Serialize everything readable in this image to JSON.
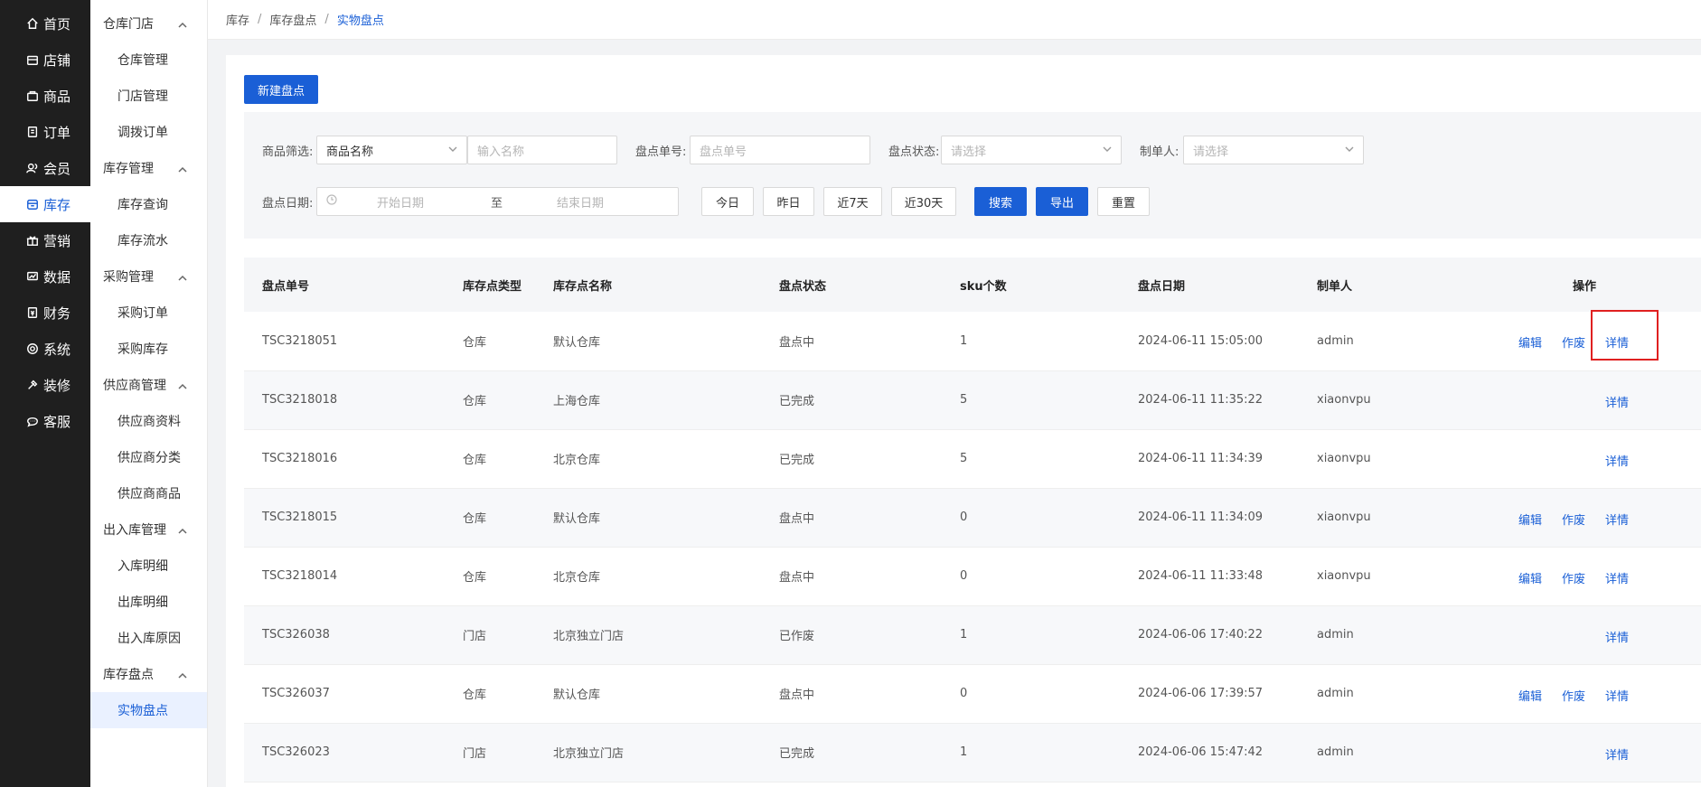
{
  "nav_primary": [
    {
      "label": "首页",
      "icon": "home-icon",
      "active": false
    },
    {
      "label": "店铺",
      "icon": "shop-icon",
      "active": false
    },
    {
      "label": "商品",
      "icon": "goods-icon",
      "active": false
    },
    {
      "label": "订单",
      "icon": "order-icon",
      "active": false
    },
    {
      "label": "会员",
      "icon": "member-icon",
      "active": false
    },
    {
      "label": "库存",
      "icon": "inventory-icon",
      "active": true
    },
    {
      "label": "营销",
      "icon": "marketing-icon",
      "active": false
    },
    {
      "label": "数据",
      "icon": "data-icon",
      "active": false
    },
    {
      "label": "财务",
      "icon": "finance-icon",
      "active": false
    },
    {
      "label": "系统",
      "icon": "system-icon",
      "active": false
    },
    {
      "label": "装修",
      "icon": "decorate-icon",
      "active": false
    },
    {
      "label": "客服",
      "icon": "service-icon",
      "active": false
    }
  ],
  "nav_secondary": {
    "groups": [
      {
        "label": "仓库门店",
        "items": [
          "仓库管理",
          "门店管理",
          "调拨订单"
        ]
      },
      {
        "label": "库存管理",
        "items": [
          "库存查询",
          "库存流水"
        ]
      },
      {
        "label": "采购管理",
        "items": [
          "采购订单",
          "采购库存"
        ]
      },
      {
        "label": "供应商管理",
        "items": [
          "供应商资料",
          "供应商分类",
          "供应商商品"
        ]
      },
      {
        "label": "出入库管理",
        "items": [
          "入库明细",
          "出库明细",
          "出入库原因"
        ]
      },
      {
        "label": "库存盘点",
        "items": [
          "实物盘点"
        ]
      }
    ],
    "active_item": "实物盘点"
  },
  "breadcrumb": [
    "库存",
    "库存盘点",
    "实物盘点"
  ],
  "new_button": "新建盘点",
  "filters": {
    "goods_label": "商品筛选:",
    "goods_select": "商品名称",
    "goods_input_placeholder": "输入名称",
    "order_no_label": "盘点单号:",
    "order_no_placeholder": "盘点单号",
    "status_label": "盘点状态:",
    "status_placeholder": "请选择",
    "creator_label": "制单人:",
    "creator_placeholder": "请选择",
    "date_label": "盘点日期:",
    "start_placeholder": "开始日期",
    "range_sep": "至",
    "end_placeholder": "结束日期",
    "quick": [
      "今日",
      "昨日",
      "近7天",
      "近30天"
    ],
    "search": "搜索",
    "export": "导出",
    "reset": "重置"
  },
  "table": {
    "columns": [
      "盘点单号",
      "库存点类型",
      "库存点名称",
      "盘点状态",
      "sku个数",
      "盘点日期",
      "制单人",
      "操作"
    ],
    "ops_labels": {
      "edit": "编辑",
      "void": "作废",
      "detail": "详情"
    },
    "rows": [
      {
        "no": "TSC3218051",
        "type": "仓库",
        "name": "默认仓库",
        "status": "盘点中",
        "sku": "1",
        "date": "2024-06-11 15:05:00",
        "creator": "admin",
        "ops": [
          "edit",
          "void",
          "detail"
        ],
        "highlight": true
      },
      {
        "no": "TSC3218018",
        "type": "仓库",
        "name": "上海仓库",
        "status": "已完成",
        "sku": "5",
        "date": "2024-06-11 11:35:22",
        "creator": "xiaonvpu",
        "ops": [
          "detail"
        ]
      },
      {
        "no": "TSC3218016",
        "type": "仓库",
        "name": "北京仓库",
        "status": "已完成",
        "sku": "5",
        "date": "2024-06-11 11:34:39",
        "creator": "xiaonvpu",
        "ops": [
          "detail"
        ]
      },
      {
        "no": "TSC3218015",
        "type": "仓库",
        "name": "默认仓库",
        "status": "盘点中",
        "sku": "0",
        "date": "2024-06-11 11:34:09",
        "creator": "xiaonvpu",
        "ops": [
          "edit",
          "void",
          "detail"
        ]
      },
      {
        "no": "TSC3218014",
        "type": "仓库",
        "name": "北京仓库",
        "status": "盘点中",
        "sku": "0",
        "date": "2024-06-11 11:33:48",
        "creator": "xiaonvpu",
        "ops": [
          "edit",
          "void",
          "detail"
        ]
      },
      {
        "no": "TSC326038",
        "type": "门店",
        "name": "北京独立门店",
        "status": "已作废",
        "sku": "1",
        "date": "2024-06-06 17:40:22",
        "creator": "admin",
        "ops": [
          "detail"
        ]
      },
      {
        "no": "TSC326037",
        "type": "仓库",
        "name": "默认仓库",
        "status": "盘点中",
        "sku": "0",
        "date": "2024-06-06 17:39:57",
        "creator": "admin",
        "ops": [
          "edit",
          "void",
          "detail"
        ]
      },
      {
        "no": "TSC326023",
        "type": "门店",
        "name": "北京独立门店",
        "status": "已完成",
        "sku": "1",
        "date": "2024-06-06 15:47:42",
        "creator": "admin",
        "ops": [
          "detail"
        ]
      }
    ]
  },
  "colors": {
    "primary": "#1a5fd6",
    "highlight": "#e02020",
    "sidebar": "#1f1f1f"
  }
}
